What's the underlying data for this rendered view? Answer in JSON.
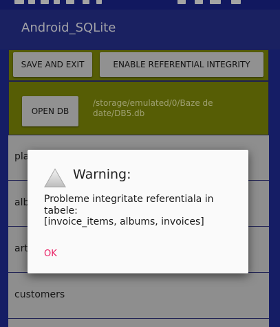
{
  "app": {
    "title": "Android_SQLite"
  },
  "toolbar": {
    "save_label": "SAVE AND EXIT",
    "enable_label": "ENABLE REFERENTIAL INTEGRITY"
  },
  "db": {
    "open_label": "OPEN DB",
    "path": "/storage/emulated/0/Baze de date/DB5.db"
  },
  "tables": [
    {
      "label": "pla"
    },
    {
      "label": "alb"
    },
    {
      "label": "art"
    },
    {
      "label": "customers"
    }
  ],
  "dialog": {
    "icon": "warning-icon",
    "title": "Warning:",
    "message_line1": "Probleme integritate referentiala in tabele:",
    "message_line2": "[invoice_items, albums, invoices]",
    "ok_label": "OK"
  },
  "colors": {
    "app_bar": "#27318f",
    "panel": "#7f8a08",
    "button": "#d6d6d6",
    "list_bg": "#d1d1d1",
    "dialog_accent": "#e91e63"
  }
}
